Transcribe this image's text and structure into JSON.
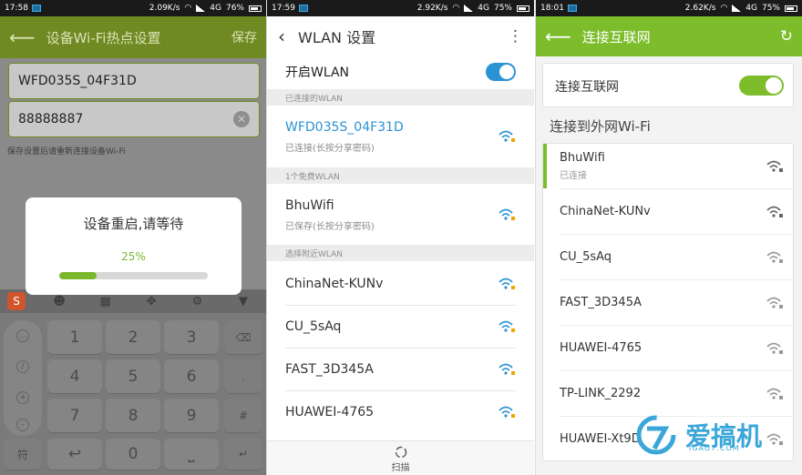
{
  "colors": {
    "green_dark": "#6f8a22",
    "green": "#7dbd2c",
    "blue": "#2a93d5",
    "progress_green": "#7ab72c"
  },
  "panel1": {
    "status": {
      "time": "17:58",
      "speed": "2.09K/s",
      "net": "4G",
      "battery": "76%"
    },
    "title": "设备Wi-Fi热点设置",
    "save": "保存",
    "ssid_value": "WFD035S_04F31D",
    "password_value": "88888887",
    "hint": "保存设置后请重新连接设备Wi-Fi",
    "dialog": {
      "message": "设备重启,请等待",
      "progress_text": "25%",
      "progress": 0.25
    },
    "keyboard": {
      "side_keys": [
        "符",
        "",
        "",
        ""
      ],
      "keys": [
        "1",
        "2",
        "3",
        "4",
        "5",
        "6",
        "7",
        "8",
        "9",
        "0"
      ],
      "right_keys": [
        "",
        "",
        "#"
      ]
    }
  },
  "panel2": {
    "status": {
      "time": "17:59",
      "speed": "2.92K/s",
      "net": "4G",
      "battery": "75%"
    },
    "title": "WLAN 设置",
    "toggle_label": "开启WLAN",
    "toggle_on": true,
    "section_connected": "已连接的WLAN",
    "connected": {
      "name": "WFD035S_04F31D",
      "status": "已连接(长按分享密码)"
    },
    "section_free": "1个免费WLAN",
    "free": {
      "name": "BhuWifi",
      "status": "已保存(长按分享密码)"
    },
    "section_nearby": "选择附近WLAN",
    "nearby": [
      "ChinaNet-KUNv",
      "CU_5sAq",
      "FAST_3D345A",
      "HUAWEI-4765"
    ],
    "scan": "扫描"
  },
  "panel3": {
    "status": {
      "time": "18:01",
      "speed": "2.62K/s",
      "net": "4G",
      "battery": "75%"
    },
    "title": "连接互联网",
    "toggle_label": "连接互联网",
    "toggle_on": true,
    "section": "连接到外网Wi-Fi",
    "networks": [
      {
        "name": "BhuWifi",
        "status": "已连接"
      },
      {
        "name": "ChinaNet-KUNv",
        "status": ""
      },
      {
        "name": "CU_5sAq",
        "status": ""
      },
      {
        "name": "FAST_3D345A",
        "status": ""
      },
      {
        "name": "HUAWEI-4765",
        "status": ""
      },
      {
        "name": "TP-LINK_2292",
        "status": ""
      },
      {
        "name": "HUAWEI-Xt9D",
        "status": ""
      }
    ]
  },
  "watermark": {
    "text": "爱搞机",
    "url": "IGAO7.COM"
  }
}
